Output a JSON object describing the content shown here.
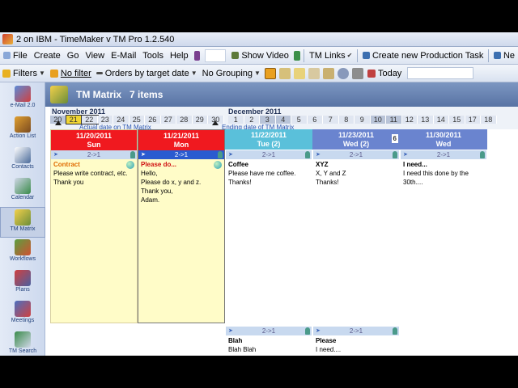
{
  "window": {
    "title": "2 on IBM - TimeMaker v TM Pro 1.2.540"
  },
  "menubar": {
    "items": [
      "File",
      "Create",
      "Go",
      "View",
      "E-Mail",
      "Tools",
      "Help"
    ],
    "show_video": "Show Video",
    "tm_links": "TM Links",
    "create_production_task": "Create new Production Task",
    "new_truncated": "Ne"
  },
  "filterbar": {
    "filters": "Filters",
    "no_filter": "No filter",
    "orders_by": "Orders by target date",
    "no_grouping": "No Grouping",
    "today": "Today"
  },
  "sidebar": {
    "items": [
      {
        "label": "e-Mail 2.0",
        "icon": "email-icon"
      },
      {
        "label": "Action List",
        "icon": "action-list-icon"
      },
      {
        "label": "Contacts",
        "icon": "contacts-icon"
      },
      {
        "label": "Calendar",
        "icon": "calendar-icon"
      },
      {
        "label": "TM Matrix",
        "icon": "matrix-icon"
      },
      {
        "label": "Workflows",
        "icon": "workflows-icon"
      },
      {
        "label": "Plans",
        "icon": "plans-icon"
      },
      {
        "label": "Meetings",
        "icon": "meetings-icon"
      },
      {
        "label": "TM Search",
        "icon": "search-icon"
      }
    ]
  },
  "header": {
    "title": "TM Matrix",
    "count": "7 items"
  },
  "timeline": {
    "months": [
      "November 2011",
      "December 2011"
    ],
    "nov_days": [
      "20",
      "21",
      "22",
      "23",
      "24",
      "25",
      "26",
      "27",
      "28",
      "29",
      "30"
    ],
    "dec_days": [
      "1",
      "2",
      "3",
      "4",
      "5",
      "6",
      "7",
      "8",
      "9",
      "10",
      "11",
      "12",
      "13",
      "14",
      "15",
      "17",
      "18"
    ],
    "actual_date_note": "Actual date on TM Matrix",
    "ending_date_note": "Ending date of TM Matrix"
  },
  "columns": [
    {
      "date": "11/20/2011",
      "weekday": "Sun",
      "color": "#f0191f"
    },
    {
      "date": "11/21/2011",
      "weekday": "Mon",
      "color": "#f0191f"
    },
    {
      "date": "11/22/2011",
      "weekday": "Tue (2)",
      "color": "#5ac0da"
    },
    {
      "date": "11/23/2011",
      "weekday": "Wed (2)",
      "color": "#6a84cf",
      "badge": "6"
    },
    {
      "date": "11/30/2011",
      "weekday": "Wed",
      "color": "#6a84cf"
    }
  ],
  "cards": [
    {
      "bar": "2->1",
      "title": "Contract",
      "body": [
        "Please write contract, etc.",
        "Thank you"
      ]
    },
    {
      "bar": "2->1",
      "title": "Please do...",
      "body": [
        "Hello,",
        "Please do x, y and z.",
        "Thank you,",
        "Adam."
      ]
    },
    {
      "bar": "2->1",
      "title": "Coffee",
      "body": [
        "Please have me coffee.",
        "Thanks!"
      ]
    },
    {
      "bar": "2->1",
      "title": "XYZ",
      "body": [
        "X, Y and Z",
        "Thanks!"
      ]
    },
    {
      "bar": "2->1",
      "title": "I need...",
      "body": [
        "I need this done by the",
        "30th...."
      ]
    },
    {
      "bar": "2->1",
      "title": "Blah",
      "body": [
        "Blah Blah"
      ]
    },
    {
      "bar": "2->1",
      "title": "Please",
      "body": [
        "I need...."
      ]
    }
  ]
}
